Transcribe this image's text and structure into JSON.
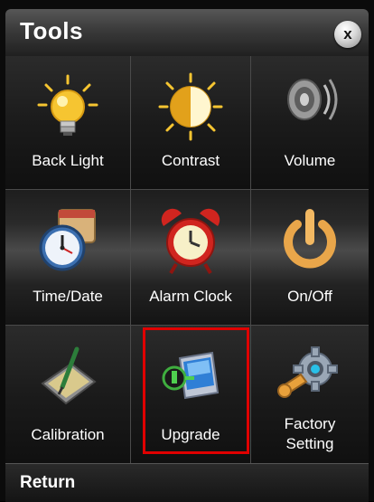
{
  "window": {
    "title": "Tools",
    "close_label": "x"
  },
  "tiles": [
    {
      "label": "Back Light",
      "icon": "lightbulb-icon"
    },
    {
      "label": "Contrast",
      "icon": "contrast-icon"
    },
    {
      "label": "Volume",
      "icon": "speaker-icon"
    },
    {
      "label": "Time/Date",
      "icon": "clock-calendar-icon"
    },
    {
      "label": "Alarm Clock",
      "icon": "alarm-clock-icon"
    },
    {
      "label": "On/Off",
      "icon": "power-icon"
    },
    {
      "label": "Calibration",
      "icon": "calibration-pen-icon"
    },
    {
      "label": "Upgrade",
      "icon": "upgrade-device-icon"
    },
    {
      "label_line1": "Factory",
      "label_line2": "Setting",
      "icon": "gear-wrench-icon"
    }
  ],
  "footer": {
    "return_label": "Return"
  },
  "colors": {
    "highlight": "#e00000",
    "accent_yellow": "#f6c531"
  }
}
